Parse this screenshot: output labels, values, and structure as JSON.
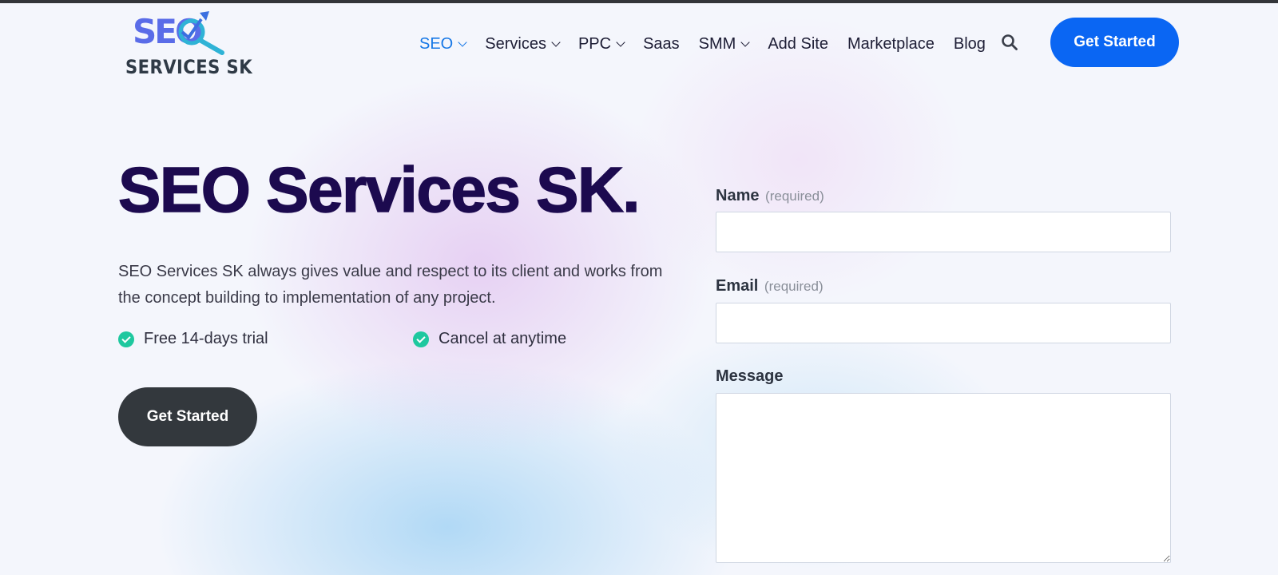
{
  "header": {
    "logo": {
      "mark_text": "SEO",
      "wordmark": "SERVICES SK"
    },
    "nav": [
      {
        "label": "SEO",
        "dropdown": true,
        "active": true
      },
      {
        "label": "Services",
        "dropdown": true,
        "active": false
      },
      {
        "label": "PPC",
        "dropdown": true,
        "active": false
      },
      {
        "label": "Saas",
        "dropdown": false,
        "active": false
      },
      {
        "label": "SMM",
        "dropdown": true,
        "active": false
      },
      {
        "label": "Add Site",
        "dropdown": false,
        "active": false
      },
      {
        "label": "Marketplace",
        "dropdown": false,
        "active": false
      },
      {
        "label": "Blog",
        "dropdown": false,
        "active": false
      }
    ],
    "search_icon": "search-icon",
    "cta_label": "Get Started"
  },
  "hero": {
    "title": "SEO Services SK.",
    "description": "SEO Services SK always gives value and respect to its client and works from the concept building to implementation of any project.",
    "features": [
      "Free 14-days trial",
      "Cancel at anytime"
    ],
    "cta_label": "Get Started"
  },
  "form": {
    "name": {
      "label": "Name",
      "hint": "(required)",
      "value": ""
    },
    "email": {
      "label": "Email",
      "hint": "(required)",
      "value": ""
    },
    "message": {
      "label": "Message",
      "value": ""
    }
  },
  "colors": {
    "nav_active": "#1778e6",
    "primary_button": "#0a66f3",
    "dark_button": "#33383d",
    "title": "#1c0a4f",
    "check": "#1ec89f"
  }
}
